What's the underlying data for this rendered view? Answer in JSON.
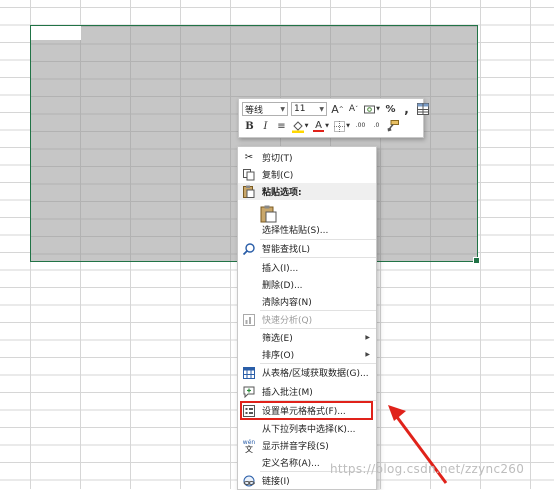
{
  "colors": {
    "accent": "#217346",
    "selection_fill": "#c6c6c6",
    "highlight": "#e0221a",
    "font_color_bar": "#e0221a",
    "fill_color_bar": "#ffd800"
  },
  "mini_toolbar": {
    "font_name": "等线",
    "font_size": "11",
    "buttons": [
      {
        "name": "increase-font-size",
        "label": "A",
        "icon": "increase-font-icon"
      },
      {
        "name": "decrease-font-size",
        "label": "A",
        "icon": "decrease-font-icon"
      },
      {
        "name": "accounting-format",
        "label": "₩",
        "icon": "accounting-icon"
      },
      {
        "name": "percent-style",
        "label": "%",
        "icon": "percent-icon"
      },
      {
        "name": "comma-style",
        "label": ",",
        "icon": "comma-icon"
      },
      {
        "name": "format-table",
        "label": "",
        "icon": "table-format-icon"
      },
      {
        "name": "bold",
        "label": "B",
        "icon": "bold-icon"
      },
      {
        "name": "italic",
        "label": "I",
        "icon": "italic-icon"
      },
      {
        "name": "align-center",
        "label": "≡",
        "icon": "align-center-icon"
      },
      {
        "name": "fill-color",
        "label": "",
        "icon": "fill-color-icon"
      },
      {
        "name": "font-color",
        "label": "A",
        "icon": "font-color-icon"
      },
      {
        "name": "borders",
        "label": "",
        "icon": "borders-icon"
      },
      {
        "name": "increase-decimal",
        "label": ".00",
        "icon": "increase-decimal-icon"
      },
      {
        "name": "decrease-decimal",
        "label": ".0",
        "icon": "decrease-decimal-icon"
      },
      {
        "name": "format-painter",
        "label": "",
        "icon": "format-painter-icon"
      }
    ]
  },
  "context_menu": {
    "items": [
      {
        "label": "剪切(T)",
        "icon": "scissors-icon"
      },
      {
        "label": "复制(C)",
        "icon": "copy-icon"
      },
      {
        "label": "粘贴选项:",
        "icon": "paste-icon"
      },
      {
        "label": "选择性粘贴(S)...",
        "icon": ""
      },
      {
        "label": "智能查找(L)",
        "icon": "smart-lookup-icon"
      },
      {
        "label": "插入(I)...",
        "icon": ""
      },
      {
        "label": "删除(D)...",
        "icon": ""
      },
      {
        "label": "清除内容(N)",
        "icon": ""
      },
      {
        "label": "快速分析(Q)",
        "icon": "quick-analysis-icon"
      },
      {
        "label": "筛选(E)",
        "icon": ""
      },
      {
        "label": "排序(O)",
        "icon": ""
      },
      {
        "label": "从表格/区域获取数据(G)...",
        "icon": "table-data-icon"
      },
      {
        "label": "插入批注(M)",
        "icon": "comment-icon"
      },
      {
        "label": "设置单元格格式(F)...",
        "icon": "format-cells-icon"
      },
      {
        "label": "从下拉列表中选择(K)...",
        "icon": ""
      },
      {
        "label": "显示拼音字段(S)",
        "icon": "phonetic-icon"
      },
      {
        "label": "定义名称(A)...",
        "icon": ""
      },
      {
        "label": "链接(I)",
        "icon": "link-icon"
      }
    ]
  },
  "watermark": "https://blog.csdn.net/zzync260"
}
